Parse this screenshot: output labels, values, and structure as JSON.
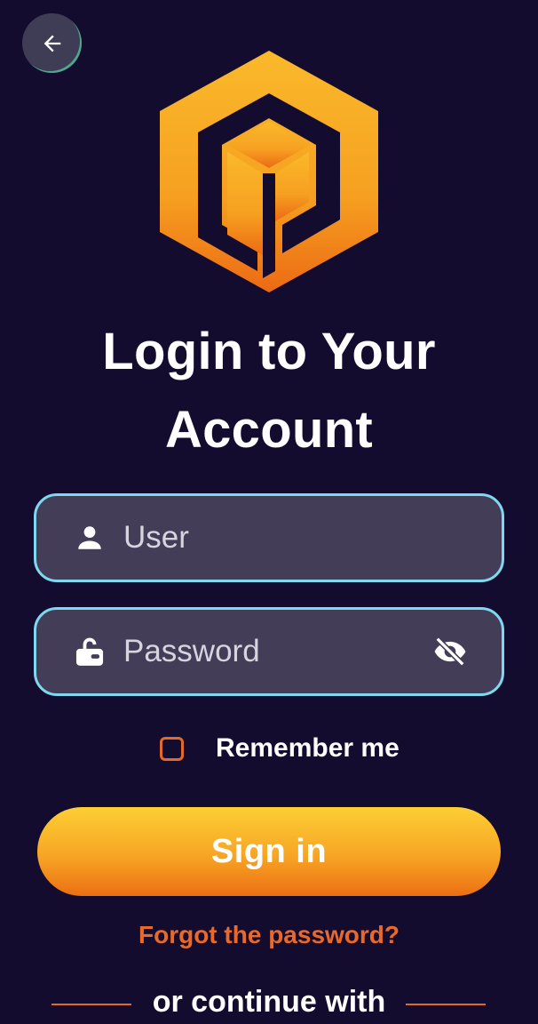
{
  "header": {
    "back_icon": "arrow-left-icon"
  },
  "logo": {
    "icon": "hexagon-cube-p-logo",
    "colors": {
      "top": "#f8b62a",
      "bottom": "#ec6f14"
    }
  },
  "title": {
    "line1": "Login to Your",
    "line2": "Account"
  },
  "form": {
    "user": {
      "icon": "person-icon",
      "placeholder": "User",
      "value": ""
    },
    "password": {
      "icon": "lock-icon",
      "placeholder": "Password",
      "value": "",
      "toggle_icon": "eye-off-icon"
    },
    "remember": {
      "label": "Remember me",
      "checked": false
    },
    "sign_in_label": "Sign in",
    "forgot_label": "Forgot the password?"
  },
  "divider": {
    "label": "or continue with"
  },
  "colors": {
    "background": "#140c2e",
    "field_fill": "#433d58",
    "field_border": "#7fd8f0",
    "accent": "#e8692a",
    "button_gradient_top": "#fdcf35",
    "button_gradient_bottom": "#ec6f14"
  }
}
